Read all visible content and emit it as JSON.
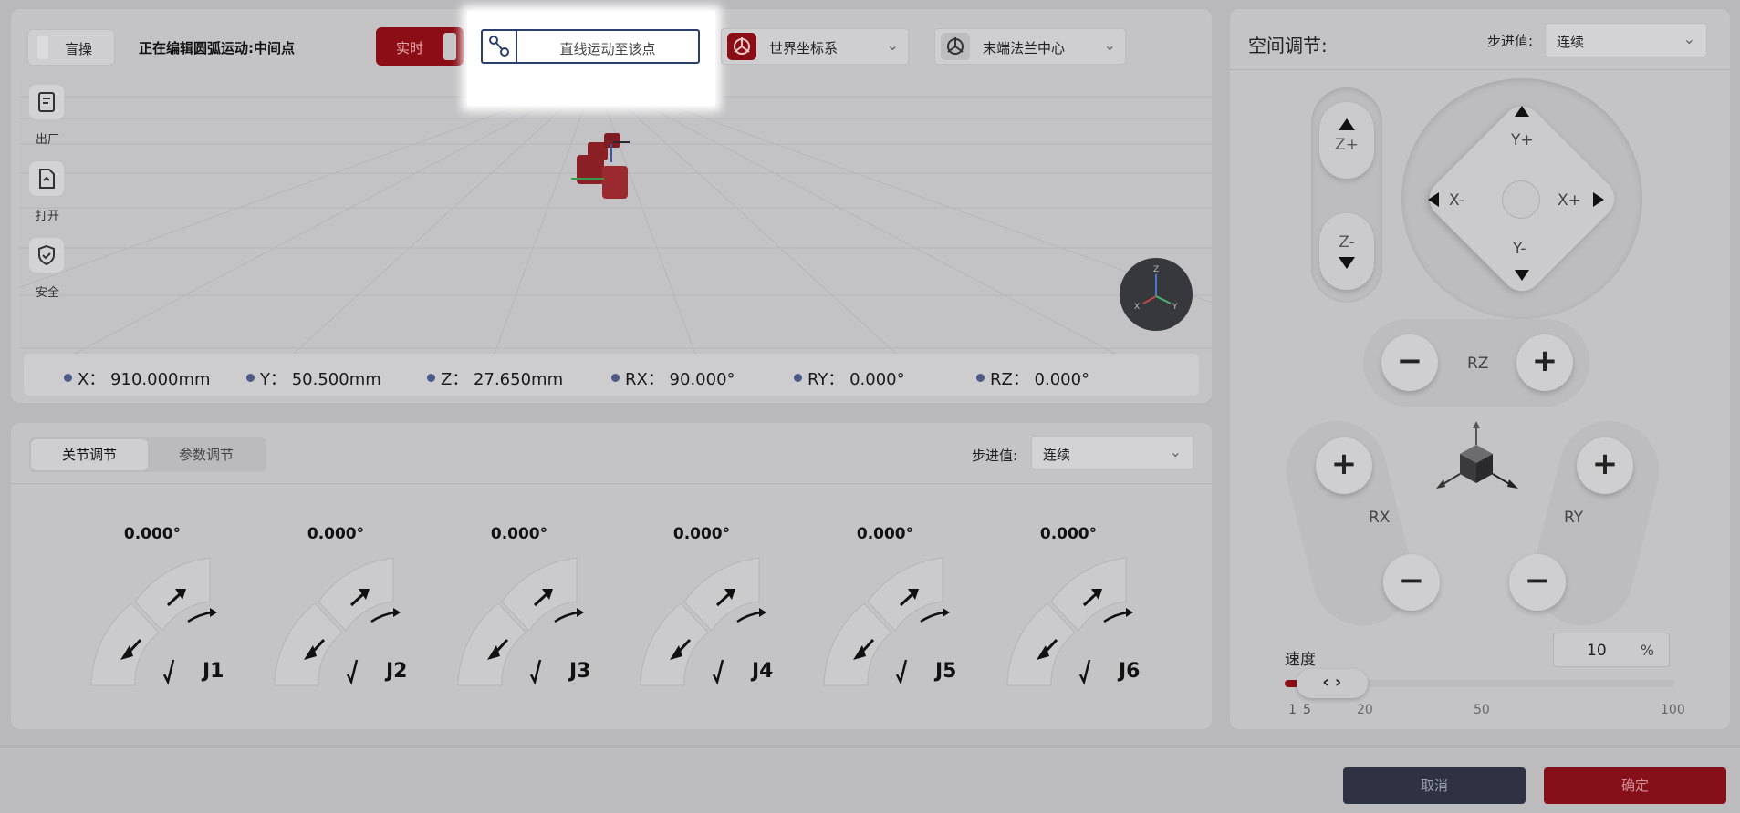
{
  "topbar": {
    "blind_label": "盲操",
    "edit_title": "正在编辑圆弧运动:中间点",
    "realtime_label": "实时",
    "linear_move_label": "直线运动至该点",
    "coord_system": "世界坐标系",
    "tool_frame": "末端法兰中心"
  },
  "sidebar": {
    "items": [
      {
        "label": "出厂",
        "icon": "factory-reset-icon"
      },
      {
        "label": "打开",
        "icon": "open-file-icon"
      },
      {
        "label": "安全",
        "icon": "shield-icon"
      }
    ]
  },
  "coords": {
    "x": "X：  910.000mm",
    "y": "Y：  50.500mm",
    "z": "Z：  27.650mm",
    "rx": "RX：  90.000°",
    "ry": "RY：  0.000°",
    "rz": "RZ：  0.000°"
  },
  "gizmo": {
    "z": "Z",
    "x": "X",
    "y": "Y"
  },
  "joint_panel": {
    "tabs": [
      "关节调节",
      "参数调节"
    ],
    "active_tab": 0,
    "step_label": "步进值:",
    "step_value": "连续",
    "joints": [
      {
        "name": "J1",
        "value": "0.000°"
      },
      {
        "name": "J2",
        "value": "0.000°"
      },
      {
        "name": "J3",
        "value": "0.000°"
      },
      {
        "name": "J4",
        "value": "0.000°"
      },
      {
        "name": "J5",
        "value": "0.000°"
      },
      {
        "name": "J6",
        "value": "0.000°"
      }
    ]
  },
  "space_panel": {
    "title": "空间调节:",
    "step_label": "步进值:",
    "step_value": "连续",
    "z_plus": "Z+",
    "z_minus": "Z-",
    "y_plus": "Y+",
    "y_minus": "Y-",
    "x_plus": "X+",
    "x_minus": "X-",
    "rz": "RZ",
    "rx": "RX",
    "ry": "RY",
    "speed_label": "速度",
    "speed_value": "10",
    "speed_unit": "%",
    "speed_ticks": [
      "1",
      "5",
      "20",
      "50",
      "100"
    ],
    "speed_fraction": 0.1
  },
  "footer": {
    "cancel": "取消",
    "confirm": "确定"
  },
  "colors": {
    "accent_red": "#8b0e16",
    "navy": "#2c3e6b",
    "dark_button": "#2e3243"
  }
}
